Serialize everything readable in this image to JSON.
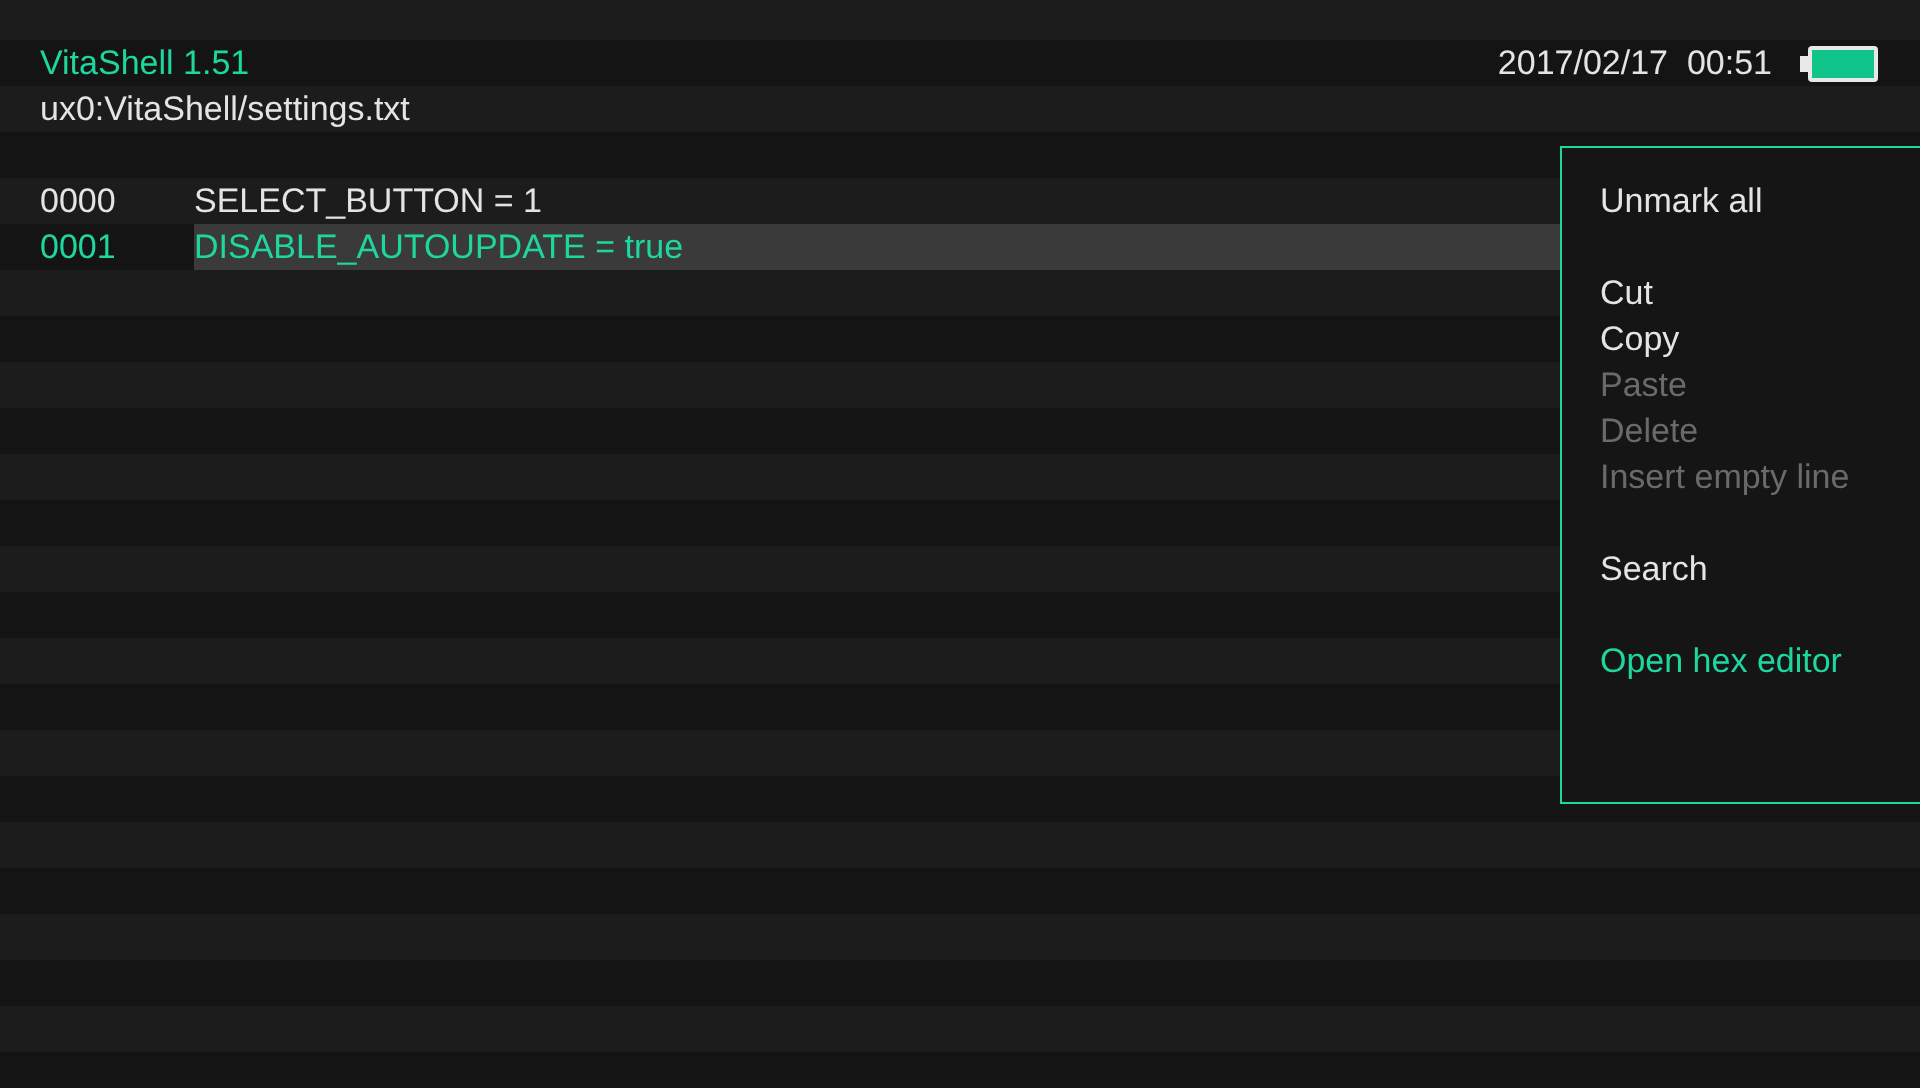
{
  "header": {
    "title": "VitaShell 1.51",
    "path": "ux0:VitaShell/settings.txt",
    "datetime": "2017/02/17  00:51"
  },
  "lines": [
    {
      "number": "0000",
      "text": "SELECT_BUTTON = 1",
      "selected": false
    },
    {
      "number": "0001",
      "text": "DISABLE_AUTOUPDATE = true",
      "selected": true
    }
  ],
  "menu": {
    "groups": [
      [
        {
          "label": "Unmark all",
          "disabled": false,
          "selected": false
        }
      ],
      [
        {
          "label": "Cut",
          "disabled": false,
          "selected": false
        },
        {
          "label": "Copy",
          "disabled": false,
          "selected": false
        },
        {
          "label": "Paste",
          "disabled": true,
          "selected": false
        },
        {
          "label": "Delete",
          "disabled": true,
          "selected": false
        },
        {
          "label": "Insert empty line",
          "disabled": true,
          "selected": false
        }
      ],
      [
        {
          "label": "Search",
          "disabled": false,
          "selected": false
        }
      ],
      [
        {
          "label": "Open hex editor",
          "disabled": false,
          "selected": true
        }
      ]
    ]
  }
}
